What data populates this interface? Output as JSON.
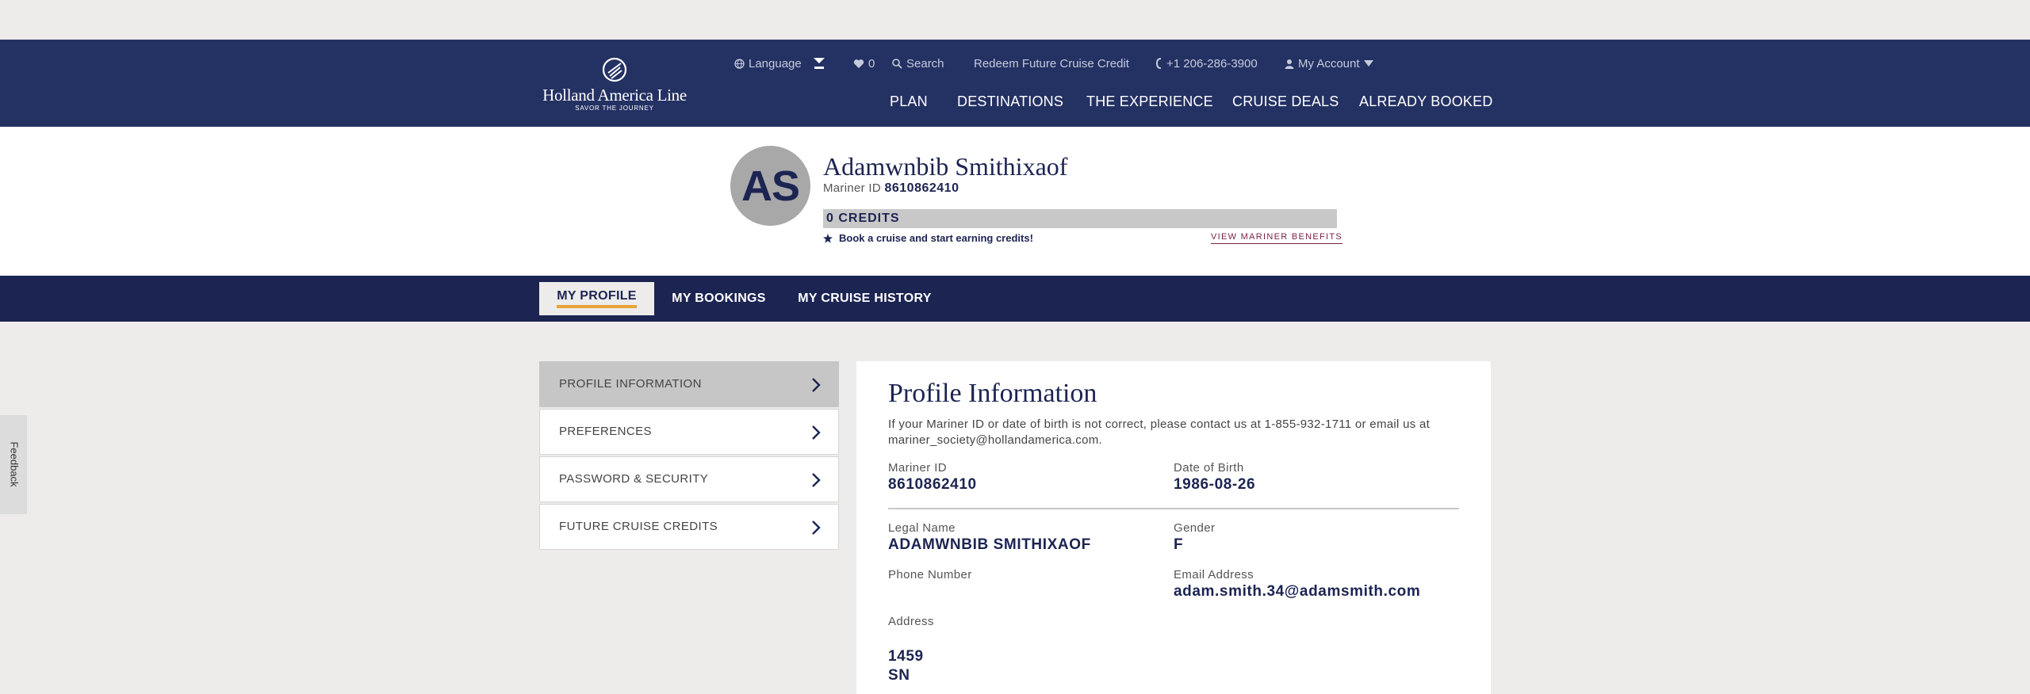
{
  "brand": {
    "name": "Holland America Line",
    "tagline": "SAVOR THE JOURNEY",
    "colors": {
      "navy": "#243163",
      "dark_navy": "#1c2452",
      "accent": "#e8a33a",
      "link": "#7a2346"
    }
  },
  "utility_nav": {
    "language": "Language",
    "favorites_count": "0",
    "search": "Search",
    "redeem": "Redeem Future Cruise Credit",
    "phone": "+1 206-286-3900",
    "account": "My Account"
  },
  "main_nav": [
    "PLAN",
    "DESTINATIONS",
    "THE EXPERIENCE",
    "CRUISE DEALS",
    "ALREADY BOOKED"
  ],
  "profile_header": {
    "initials": "AS",
    "name": "Adamwnbib Smithixaof",
    "mariner_label": "Mariner ID",
    "mariner_id": "8610862410",
    "credits": "0 CREDITS",
    "earn_text": "Book a cruise and start earning credits!",
    "benefits_link": "VIEW MARINER BENEFITS"
  },
  "tabs": [
    "MY PROFILE",
    "MY BOOKINGS",
    "MY CRUISE HISTORY"
  ],
  "sidebar": [
    {
      "label": "PROFILE INFORMATION",
      "active": true
    },
    {
      "label": "PREFERENCES",
      "active": false
    },
    {
      "label": "PASSWORD & SECURITY",
      "active": false
    },
    {
      "label": "FUTURE CRUISE CREDITS",
      "active": false
    }
  ],
  "profile_info": {
    "title": "Profile Information",
    "intro": "If your Mariner ID or date of birth is not correct, please contact us at 1-855-932-1711 or email us at mariner_society@hollandamerica.com.",
    "mariner_id_label": "Mariner ID",
    "mariner_id": "8610862410",
    "dob_label": "Date of Birth",
    "dob": "1986-08-26",
    "legal_name_label": "Legal Name",
    "legal_name": "ADAMWNBIB SMITHIXAOF",
    "gender_label": "Gender",
    "gender": "F",
    "phone_label": "Phone Number",
    "phone": "",
    "email_label": "Email Address",
    "email": "adam.smith.34@adamsmith.com",
    "address_label": "Address",
    "address_line1": "1459",
    "address_line2": "SN"
  },
  "feedback": "Feedback"
}
